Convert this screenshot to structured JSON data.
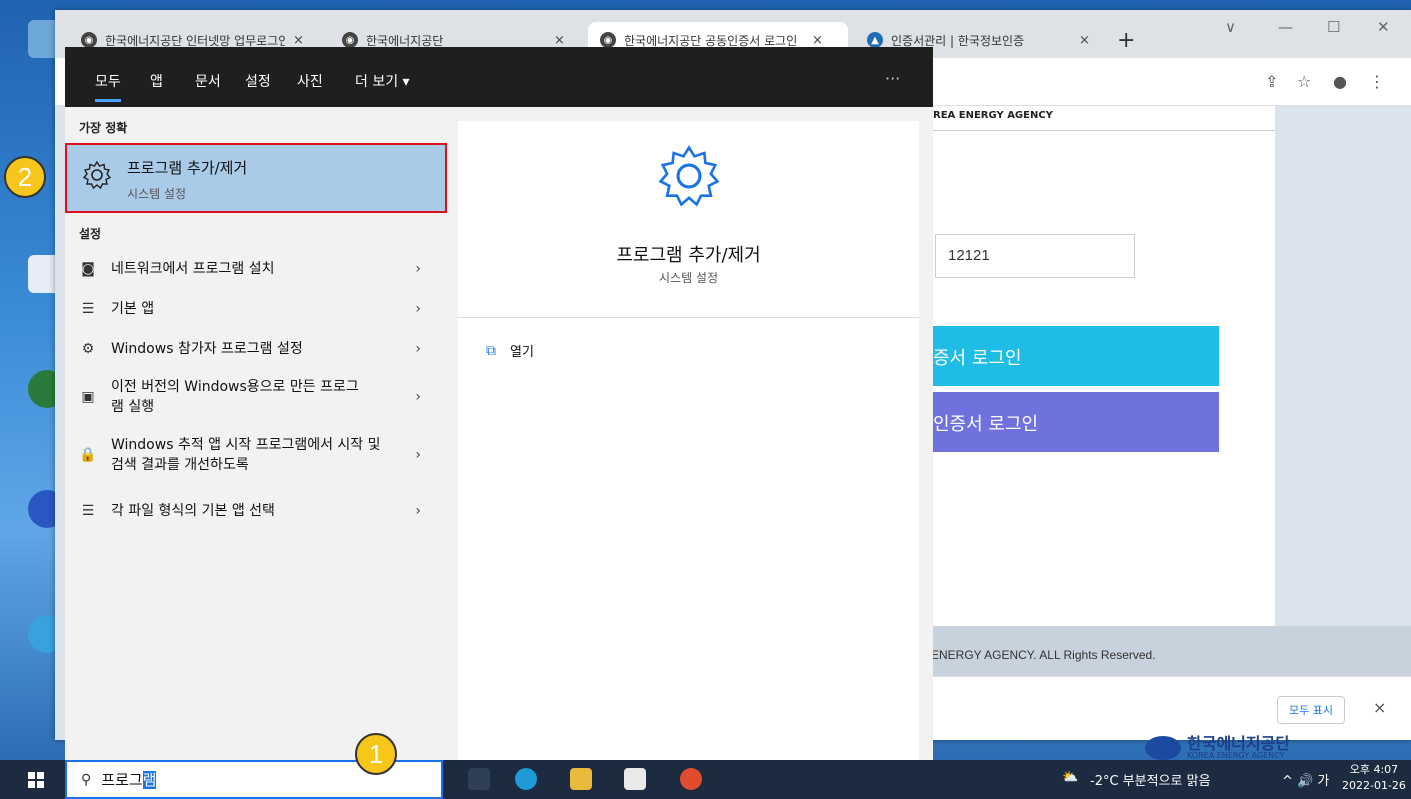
{
  "browser": {
    "tabs": [
      {
        "title": "한국에너지공단 인터넷망 업무로그인",
        "close": "×"
      },
      {
        "title": "한국에너지공단",
        "close": "×"
      },
      {
        "title": "한국에너지공단 공동인증서 로그인",
        "close": "×"
      },
      {
        "title": "인증서관리 | 한국정보인증",
        "close": "×"
      }
    ],
    "new_tab": "+",
    "window_controls": [
      "∨",
      "—",
      "☐",
      "✕"
    ],
    "toolbar_icons": [
      "share-icon",
      "star-icon",
      "profile-icon",
      "menu-icon"
    ]
  },
  "page": {
    "agency": "REA ENERGY AGENCY",
    "id_value": "12121",
    "login1": "증서 로그인",
    "login2": "인증서 로그인",
    "footer": "ENERGY AGENCY. ALL Rights Reserved.",
    "show_all": "모두 표시",
    "close": "×",
    "logo_main": "한국에너지공단",
    "logo_sub": "KOREA ENERGY AGENCY"
  },
  "start_menu": {
    "filters": [
      "모두",
      "앱",
      "문서",
      "설정",
      "사진",
      "더 보기 ▾"
    ],
    "more": "···",
    "best_match_header": "가장 정확",
    "best_match": {
      "title": "프로그램 추가/제거",
      "subtitle": "시스템 설정"
    },
    "settings_header": "설정",
    "settings_items": [
      {
        "icon": "network-install-icon",
        "text": "네트워크에서 프로그램 설치"
      },
      {
        "icon": "list-icon",
        "text": "기본 앱"
      },
      {
        "icon": "gear-icon",
        "text": "Windows 참가자 프로그램 설정"
      },
      {
        "icon": "window-icon",
        "text": "이전 버전의 Windows용으로 만든 프로그램 실행"
      },
      {
        "icon": "lock-icon",
        "text": "Windows 추적 앱 시작 프로그램에서 시작 및 검색 결과를 개선하도록"
      },
      {
        "icon": "list-icon",
        "text": "각 파일 형식의 기본 앱 선택"
      }
    ],
    "detail": {
      "title": "프로그램 추가/제거",
      "subtitle": "시스템 설정",
      "open_label": "열기"
    }
  },
  "taskbar": {
    "search_text": "프로그",
    "search_selected": "램",
    "weather": "-2°C 부분적으로 맑음",
    "tray": "^ 🔊 가",
    "time": "오후 4:07",
    "date": "2022-01-26"
  },
  "callouts": {
    "one": "1",
    "two": "2"
  },
  "colors": {
    "highlight": "#a9cbe8",
    "red_border": "#e0101b",
    "login1": "#1fbce6",
    "login2": "#6f72dc",
    "callout": "#f7c61a"
  }
}
